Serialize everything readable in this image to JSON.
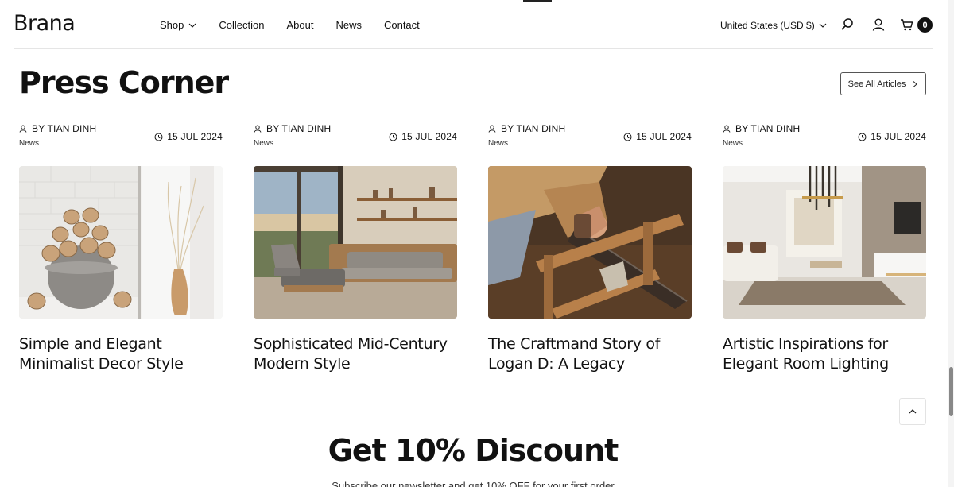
{
  "header": {
    "logo": "Brana",
    "nav": [
      {
        "label": "Shop"
      },
      {
        "label": "Collection"
      },
      {
        "label": "About"
      },
      {
        "label": "News"
      },
      {
        "label": "Contact"
      }
    ],
    "currency": "United States (USD $)",
    "cart_count": "0"
  },
  "section": {
    "title": "Press Corner",
    "see_all_label": "See All Articles"
  },
  "articles": [
    {
      "author": "BY TIAN DINH",
      "tag": "News",
      "date": "15 JUL 2024",
      "title": "Simple and Elegant Minimalist Decor Style"
    },
    {
      "author": "BY TIAN DINH",
      "tag": "News",
      "date": "15 JUL 2024",
      "title": "Sophisticated Mid-Century Modern Style"
    },
    {
      "author": "BY TIAN DINH",
      "tag": "News",
      "date": "15 JUL 2024",
      "title": "The Craftmand Story of Logan D: A Legacy"
    },
    {
      "author": "BY TIAN DINH",
      "tag": "News",
      "date": "15 JUL 2024",
      "title": "Artistic Inspirations for Elegant Room Lighting"
    }
  ],
  "discount": {
    "title": "Get 10% Discount",
    "subtitle": "Subscribe our newsletter and get 10% OFF for your first order"
  }
}
